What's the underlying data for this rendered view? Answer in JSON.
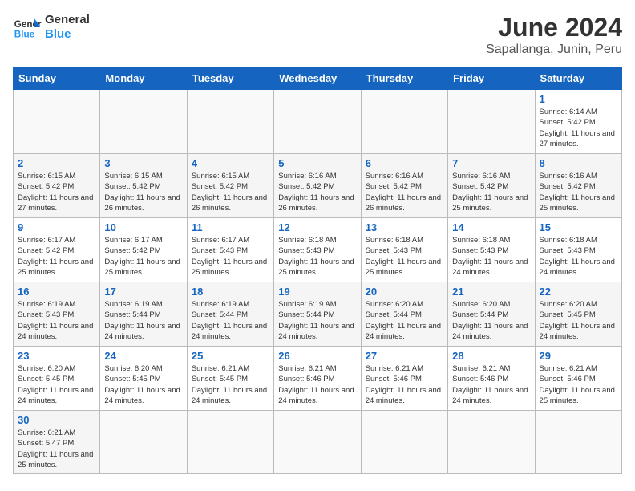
{
  "header": {
    "logo_general": "General",
    "logo_blue": "Blue",
    "month_title": "June 2024",
    "subtitle": "Sapallanga, Junin, Peru"
  },
  "weekdays": [
    "Sunday",
    "Monday",
    "Tuesday",
    "Wednesday",
    "Thursday",
    "Friday",
    "Saturday"
  ],
  "weeks": [
    [
      {
        "day": "",
        "info": ""
      },
      {
        "day": "",
        "info": ""
      },
      {
        "day": "",
        "info": ""
      },
      {
        "day": "",
        "info": ""
      },
      {
        "day": "",
        "info": ""
      },
      {
        "day": "",
        "info": ""
      },
      {
        "day": "1",
        "info": "Sunrise: 6:14 AM\nSunset: 5:42 PM\nDaylight: 11 hours and 27 minutes."
      }
    ],
    [
      {
        "day": "2",
        "info": "Sunrise: 6:15 AM\nSunset: 5:42 PM\nDaylight: 11 hours and 27 minutes."
      },
      {
        "day": "3",
        "info": "Sunrise: 6:15 AM\nSunset: 5:42 PM\nDaylight: 11 hours and 26 minutes."
      },
      {
        "day": "4",
        "info": "Sunrise: 6:15 AM\nSunset: 5:42 PM\nDaylight: 11 hours and 26 minutes."
      },
      {
        "day": "5",
        "info": "Sunrise: 6:16 AM\nSunset: 5:42 PM\nDaylight: 11 hours and 26 minutes."
      },
      {
        "day": "6",
        "info": "Sunrise: 6:16 AM\nSunset: 5:42 PM\nDaylight: 11 hours and 26 minutes."
      },
      {
        "day": "7",
        "info": "Sunrise: 6:16 AM\nSunset: 5:42 PM\nDaylight: 11 hours and 25 minutes."
      },
      {
        "day": "8",
        "info": "Sunrise: 6:16 AM\nSunset: 5:42 PM\nDaylight: 11 hours and 25 minutes."
      }
    ],
    [
      {
        "day": "9",
        "info": "Sunrise: 6:17 AM\nSunset: 5:42 PM\nDaylight: 11 hours and 25 minutes."
      },
      {
        "day": "10",
        "info": "Sunrise: 6:17 AM\nSunset: 5:42 PM\nDaylight: 11 hours and 25 minutes."
      },
      {
        "day": "11",
        "info": "Sunrise: 6:17 AM\nSunset: 5:43 PM\nDaylight: 11 hours and 25 minutes."
      },
      {
        "day": "12",
        "info": "Sunrise: 6:18 AM\nSunset: 5:43 PM\nDaylight: 11 hours and 25 minutes."
      },
      {
        "day": "13",
        "info": "Sunrise: 6:18 AM\nSunset: 5:43 PM\nDaylight: 11 hours and 25 minutes."
      },
      {
        "day": "14",
        "info": "Sunrise: 6:18 AM\nSunset: 5:43 PM\nDaylight: 11 hours and 24 minutes."
      },
      {
        "day": "15",
        "info": "Sunrise: 6:18 AM\nSunset: 5:43 PM\nDaylight: 11 hours and 24 minutes."
      }
    ],
    [
      {
        "day": "16",
        "info": "Sunrise: 6:19 AM\nSunset: 5:43 PM\nDaylight: 11 hours and 24 minutes."
      },
      {
        "day": "17",
        "info": "Sunrise: 6:19 AM\nSunset: 5:44 PM\nDaylight: 11 hours and 24 minutes."
      },
      {
        "day": "18",
        "info": "Sunrise: 6:19 AM\nSunset: 5:44 PM\nDaylight: 11 hours and 24 minutes."
      },
      {
        "day": "19",
        "info": "Sunrise: 6:19 AM\nSunset: 5:44 PM\nDaylight: 11 hours and 24 minutes."
      },
      {
        "day": "20",
        "info": "Sunrise: 6:20 AM\nSunset: 5:44 PM\nDaylight: 11 hours and 24 minutes."
      },
      {
        "day": "21",
        "info": "Sunrise: 6:20 AM\nSunset: 5:44 PM\nDaylight: 11 hours and 24 minutes."
      },
      {
        "day": "22",
        "info": "Sunrise: 6:20 AM\nSunset: 5:45 PM\nDaylight: 11 hours and 24 minutes."
      }
    ],
    [
      {
        "day": "23",
        "info": "Sunrise: 6:20 AM\nSunset: 5:45 PM\nDaylight: 11 hours and 24 minutes."
      },
      {
        "day": "24",
        "info": "Sunrise: 6:20 AM\nSunset: 5:45 PM\nDaylight: 11 hours and 24 minutes."
      },
      {
        "day": "25",
        "info": "Sunrise: 6:21 AM\nSunset: 5:45 PM\nDaylight: 11 hours and 24 minutes."
      },
      {
        "day": "26",
        "info": "Sunrise: 6:21 AM\nSunset: 5:46 PM\nDaylight: 11 hours and 24 minutes."
      },
      {
        "day": "27",
        "info": "Sunrise: 6:21 AM\nSunset: 5:46 PM\nDaylight: 11 hours and 24 minutes."
      },
      {
        "day": "28",
        "info": "Sunrise: 6:21 AM\nSunset: 5:46 PM\nDaylight: 11 hours and 24 minutes."
      },
      {
        "day": "29",
        "info": "Sunrise: 6:21 AM\nSunset: 5:46 PM\nDaylight: 11 hours and 25 minutes."
      }
    ],
    [
      {
        "day": "30",
        "info": "Sunrise: 6:21 AM\nSunset: 5:47 PM\nDaylight: 11 hours and 25 minutes."
      },
      {
        "day": "",
        "info": ""
      },
      {
        "day": "",
        "info": ""
      },
      {
        "day": "",
        "info": ""
      },
      {
        "day": "",
        "info": ""
      },
      {
        "day": "",
        "info": ""
      },
      {
        "day": "",
        "info": ""
      }
    ]
  ]
}
